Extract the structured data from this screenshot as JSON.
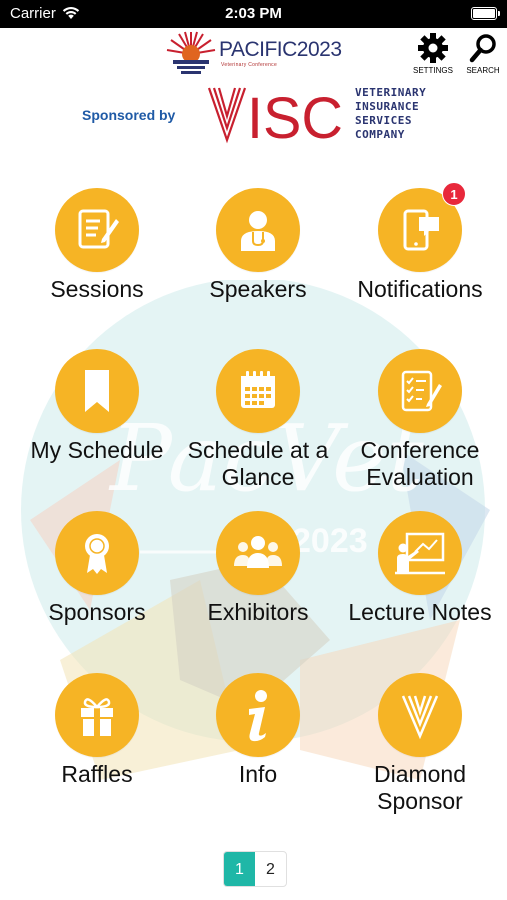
{
  "status_bar": {
    "carrier": "Carrier",
    "time": "2:03 PM"
  },
  "header": {
    "logo_text": "PACIFIC2023",
    "logo_subtitle": "Veterinary Conference",
    "settings_label": "SETTINGS",
    "search_label": "SEARCH"
  },
  "sponsor": {
    "label": "Sponsored by",
    "name_lines": [
      "VETERINARY",
      "INSURANCE",
      "SERVICES",
      "COMPANY"
    ],
    "brand_colors": {
      "visc_red": "#c8202f",
      "visc_navy": "#2a3470"
    }
  },
  "background_art": {
    "text": "PacVet",
    "year": "2023"
  },
  "menu_items": [
    {
      "label_lines": [
        "Sessions"
      ],
      "icon": "document-pen-icon"
    },
    {
      "label_lines": [
        "Speakers"
      ],
      "icon": "doctor-icon"
    },
    {
      "label_lines": [
        "Notifications"
      ],
      "icon": "phone-chat-icon",
      "badge": "1"
    },
    {
      "label_lines": [
        "My Schedule"
      ],
      "icon": "bookmark-icon"
    },
    {
      "label_lines": [
        "Schedule at a",
        "Glance"
      ],
      "icon": "calendar-icon"
    },
    {
      "label_lines": [
        "Conference",
        "Evaluation"
      ],
      "icon": "checklist-icon"
    },
    {
      "label_lines": [
        "Sponsors"
      ],
      "icon": "award-ribbon-icon"
    },
    {
      "label_lines": [
        "Exhibitors"
      ],
      "icon": "people-group-icon"
    },
    {
      "label_lines": [
        "Lecture Notes"
      ],
      "icon": "presenter-board-icon"
    },
    {
      "label_lines": [
        "Raffles"
      ],
      "icon": "gift-icon"
    },
    {
      "label_lines": [
        "Info"
      ],
      "icon": "info-icon"
    },
    {
      "label_lines": [
        "Diamond",
        "Sponsor"
      ],
      "icon": "visc-v-icon"
    }
  ],
  "pagination": {
    "pages": [
      "1",
      "2"
    ],
    "current": "1"
  },
  "colors": {
    "icon_circle": "#f6b425",
    "badge": "#e8283b",
    "page_active": "#1fb7a7",
    "sponsor_label": "#1f5aa6"
  }
}
